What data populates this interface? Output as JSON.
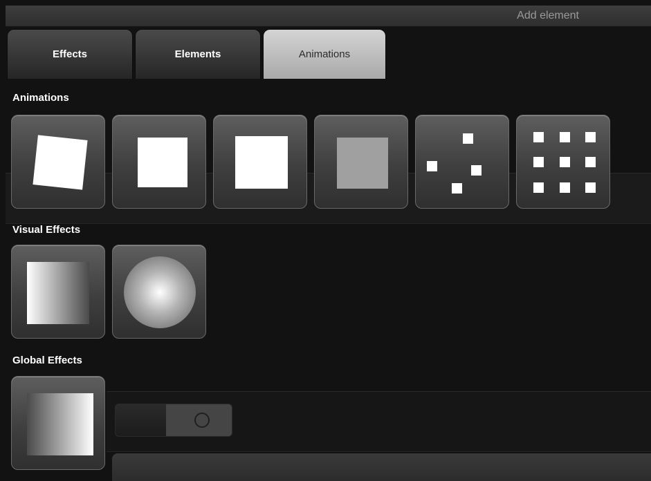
{
  "header": {
    "title": "Add element"
  },
  "tabs": [
    {
      "label": "Effects",
      "active": false
    },
    {
      "label": "Elements",
      "active": false
    },
    {
      "label": "Animations",
      "active": true
    }
  ],
  "sections": {
    "animations": {
      "label": "Animations"
    },
    "visual_effects": {
      "label": "Visual Effects"
    },
    "global_effects": {
      "label": "Global Effects"
    }
  },
  "icons": {
    "animations": [
      "rotate-square-icon",
      "square-icon",
      "scale-square-icon",
      "fade-square-icon",
      "scatter-dots-icon",
      "dot-grid-icon"
    ],
    "visual_effects": [
      "linear-gradient-icon",
      "radial-gradient-icon"
    ],
    "global_effects": [
      "global-gradient-icon"
    ]
  },
  "colors": {
    "background": "#121212",
    "tile": "#4a4a4a",
    "active_tab": "#bdbdbd",
    "accent_white": "#ffffff"
  }
}
